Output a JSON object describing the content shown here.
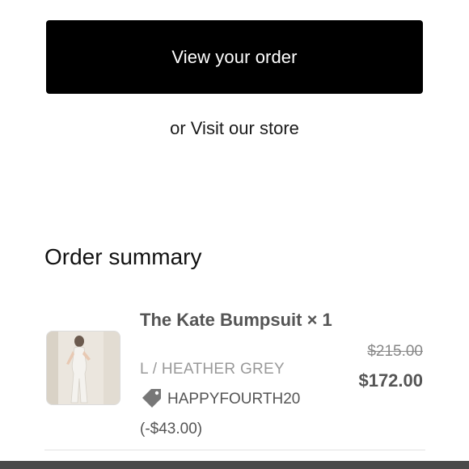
{
  "actions": {
    "view_order_label": "View your order",
    "visit_prefix": "or ",
    "visit_store_label": "Visit our store"
  },
  "summary": {
    "title": "Order summary",
    "items": [
      {
        "name": "The Kate Bumpsuit × 1",
        "variant": "L / HEATHER GREY",
        "discount_code": "HAPPYFOURTH20 (-$43.00)",
        "original_price": "$215.00",
        "final_price": "$172.00",
        "thumbnail_icon": "product-photo"
      }
    ]
  },
  "colors": {
    "primary_button": "#000000",
    "text": "#1a1a1a",
    "muted": "#999999"
  }
}
